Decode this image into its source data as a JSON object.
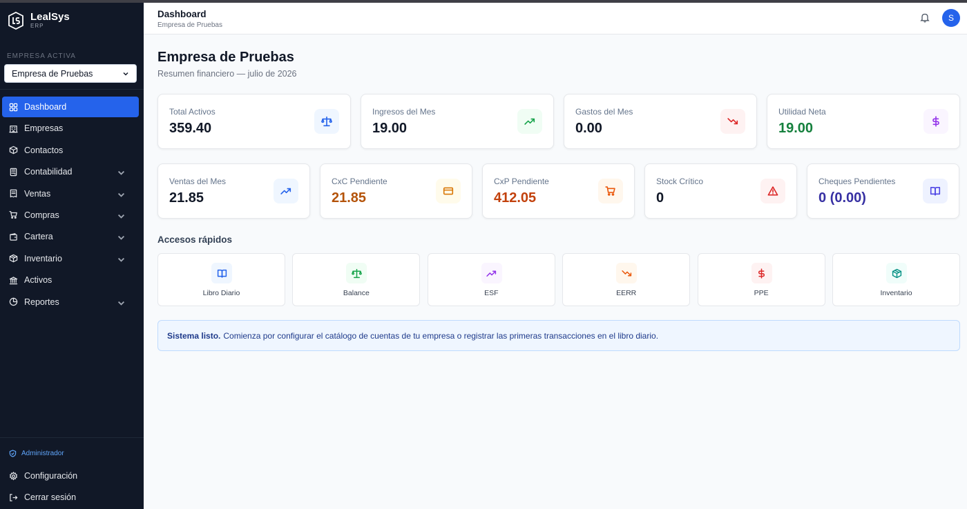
{
  "app": {
    "name": "LealSys",
    "sub": "ERP"
  },
  "empresa": {
    "label": "EMPRESA ACTIVA",
    "selected": "Empresa de Pruebas"
  },
  "nav": [
    {
      "label": "Dashboard",
      "icon": "grid-icon",
      "active": true,
      "chevron": false
    },
    {
      "label": "Empresas",
      "icon": "building-icon",
      "chevron": false
    },
    {
      "label": "Contactos",
      "icon": "box-icon",
      "chevron": false
    },
    {
      "label": "Contabilidad",
      "icon": "calculator-icon",
      "chevron": true
    },
    {
      "label": "Ventas",
      "icon": "receipt-icon",
      "chevron": true
    },
    {
      "label": "Compras",
      "icon": "cart-icon",
      "chevron": true
    },
    {
      "label": "Cartera",
      "icon": "wallet-icon",
      "chevron": true
    },
    {
      "label": "Inventario",
      "icon": "package-icon",
      "chevron": true
    },
    {
      "label": "Activos",
      "icon": "bank-icon",
      "chevron": false
    },
    {
      "label": "Reportes",
      "icon": "pie-chart-icon",
      "chevron": true
    }
  ],
  "footer": {
    "role": "Administrador",
    "config": "Configuración",
    "logout": "Cerrar sesión"
  },
  "header": {
    "title": "Dashboard",
    "subtitle": "Empresa de Pruebas",
    "avatar": "S"
  },
  "page": {
    "title": "Empresa de Pruebas",
    "subtitle": "Resumen financiero — julio de 2026"
  },
  "stats_row1": [
    {
      "label": "Total Activos",
      "value": "359.40",
      "icon": "scale-icon",
      "color": "#111827",
      "iconColor": "#2563eb",
      "iconBg": "#eff6ff"
    },
    {
      "label": "Ingresos del Mes",
      "value": "19.00",
      "icon": "trending-up-icon",
      "color": "#111827",
      "iconColor": "#16a34a",
      "iconBg": "#f0fdf4"
    },
    {
      "label": "Gastos del Mes",
      "value": "0.00",
      "icon": "trending-down-icon",
      "color": "#111827",
      "iconColor": "#dc2626",
      "iconBg": "#fef2f2"
    },
    {
      "label": "Utilidad Neta",
      "value": "19.00",
      "icon": "dollar-icon",
      "color": "#15803d",
      "iconColor": "#9333ea",
      "iconBg": "#faf5ff"
    }
  ],
  "stats_row2": [
    {
      "label": "Ventas del Mes",
      "value": "21.85",
      "icon": "trending-up-icon",
      "color": "#111827",
      "iconColor": "#2563eb",
      "iconBg": "#eff6ff"
    },
    {
      "label": "CxC Pendiente",
      "value": "21.85",
      "icon": "credit-card-icon",
      "color": "#b45309",
      "iconColor": "#d97706",
      "iconBg": "#fffbeb"
    },
    {
      "label": "CxP Pendiente",
      "value": "412.05",
      "icon": "cart-icon",
      "color": "#c2410c",
      "iconColor": "#ea580c",
      "iconBg": "#fff7ed"
    },
    {
      "label": "Stock Crítico",
      "value": "0",
      "icon": "warning-icon",
      "color": "#111827",
      "iconColor": "#dc2626",
      "iconBg": "#fef2f2"
    },
    {
      "label": "Cheques Pendientes",
      "value": "0 (0.00)",
      "icon": "book-icon",
      "color": "#3730a3",
      "iconColor": "#4f46e5",
      "iconBg": "#eef2ff"
    }
  ],
  "quick_title": "Accesos rápidos",
  "quick": [
    {
      "label": "Libro Diario",
      "icon": "book-icon",
      "iconColor": "#2563eb",
      "iconBg": "#eff6ff"
    },
    {
      "label": "Balance",
      "icon": "scale-icon",
      "iconColor": "#16a34a",
      "iconBg": "#f0fdf4"
    },
    {
      "label": "ESF",
      "icon": "trending-up-icon",
      "iconColor": "#9333ea",
      "iconBg": "#faf5ff"
    },
    {
      "label": "EERR",
      "icon": "trending-down-icon",
      "iconColor": "#ea580c",
      "iconBg": "#fff7ed"
    },
    {
      "label": "PPE",
      "icon": "dollar-icon",
      "iconColor": "#dc2626",
      "iconBg": "#fef2f2"
    },
    {
      "label": "Inventario",
      "icon": "package-icon",
      "iconColor": "#0d9488",
      "iconBg": "#f0fdfa"
    }
  ],
  "alert": {
    "strong": "Sistema listo.",
    "text": "Comienza por configurar el catálogo de cuentas de tu empresa o registrar las primeras transacciones en el libro diario."
  }
}
